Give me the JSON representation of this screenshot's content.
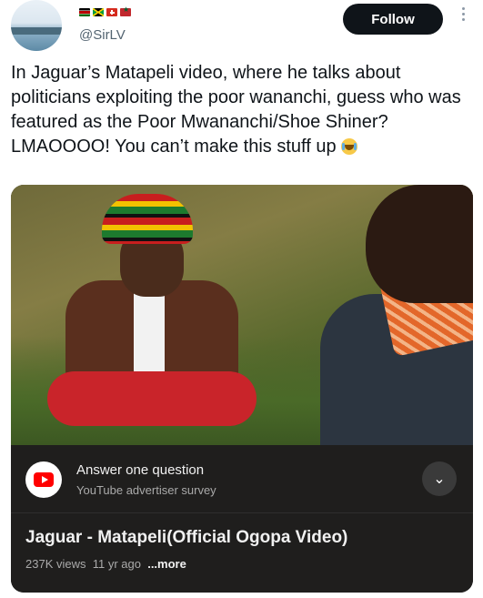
{
  "author": {
    "handle": "@SirLV",
    "flags": [
      "flag-kenya-icon",
      "flag-jamaica-icon",
      "flag-switzerland-icon",
      "flag-morocco-icon"
    ]
  },
  "actions": {
    "follow_label": "Follow",
    "more_icon": "more-vertical-icon"
  },
  "tweet": {
    "text": "In Jaguar’s Matapeli video, where he talks about politicians exploiting the poor wananchi, guess who was featured as the Poor Mwananchi/Shoe Shiner? LMAOOOO! You can’t make this stuff up",
    "emoji": "loudly-crying-face-icon"
  },
  "video_card": {
    "survey_title": "Answer one question",
    "survey_subtitle": "YouTube advertiser survey",
    "title": "Jaguar - Matapeli(Official Ogopa Video)",
    "views": "237K views",
    "age": "11 yr ago",
    "more_label": "...more"
  },
  "colors": {
    "follow_bg": "#0f1419",
    "card_bg": "#1f1e1d",
    "youtube_red": "#ff0000"
  }
}
